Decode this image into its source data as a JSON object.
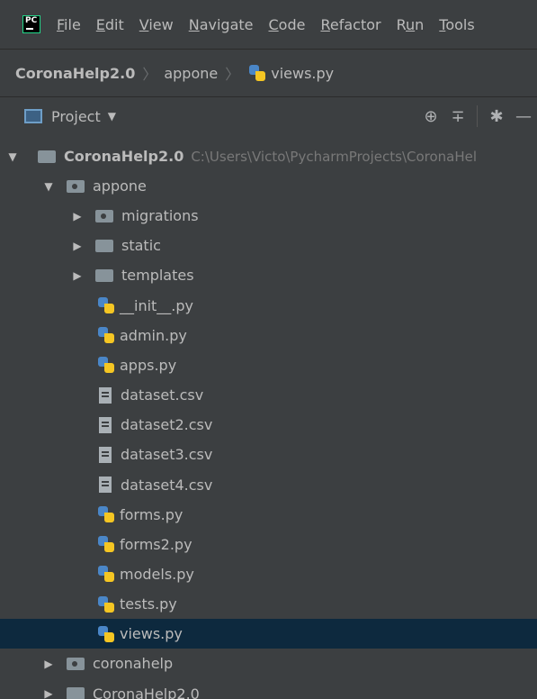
{
  "menubar": {
    "logo_text": "PC",
    "items": [
      "File",
      "Edit",
      "View",
      "Navigate",
      "Code",
      "Refactor",
      "Run",
      "Tools"
    ],
    "mnemonics": [
      "F",
      "E",
      "V",
      "N",
      "C",
      "R",
      "u",
      "T"
    ]
  },
  "breadcrumb": {
    "project": "CoronaHelp2.0",
    "folder": "appone",
    "file": "views.py"
  },
  "toolwindow": {
    "label": "Project",
    "icons": [
      "locate-icon",
      "collapse-all-icon",
      "gear-icon",
      "minimize-icon"
    ]
  },
  "tree": {
    "root_label": "CoronaHelp2.0",
    "root_path": "C:\\Users\\Victo\\PycharmProjects\\CoronaHel",
    "items": [
      {
        "label": "appone",
        "type": "package",
        "depth": 1,
        "expanded": true
      },
      {
        "label": "migrations",
        "type": "package",
        "depth": 2,
        "expanded": false
      },
      {
        "label": "static",
        "type": "folder",
        "depth": 2,
        "expanded": false
      },
      {
        "label": "templates",
        "type": "folder",
        "depth": 2,
        "expanded": false
      },
      {
        "label": "__init__.py",
        "type": "python",
        "depth": 3
      },
      {
        "label": "admin.py",
        "type": "python",
        "depth": 3
      },
      {
        "label": "apps.py",
        "type": "python",
        "depth": 3
      },
      {
        "label": "dataset.csv",
        "type": "text",
        "depth": 3
      },
      {
        "label": "dataset2.csv",
        "type": "text",
        "depth": 3
      },
      {
        "label": "dataset3.csv",
        "type": "text",
        "depth": 3
      },
      {
        "label": "dataset4.csv",
        "type": "text",
        "depth": 3
      },
      {
        "label": "forms.py",
        "type": "python",
        "depth": 3
      },
      {
        "label": "forms2.py",
        "type": "python",
        "depth": 3
      },
      {
        "label": "models.py",
        "type": "python",
        "depth": 3
      },
      {
        "label": "tests.py",
        "type": "python",
        "depth": 3
      },
      {
        "label": "views.py",
        "type": "python",
        "depth": 3,
        "selected": true
      },
      {
        "label": "coronahelp",
        "type": "package",
        "depth": 1,
        "expanded": false
      },
      {
        "label": "CoronaHelp2.0",
        "type": "folder",
        "depth": 1,
        "expanded": false
      }
    ]
  },
  "colors": {
    "background": "#3c3f41",
    "selection": "#0d293e",
    "text": "#bbbbbb",
    "path_text": "#787878",
    "folder": "#87939a",
    "python_blue": "#4a86c7",
    "python_yellow": "#f5c623"
  }
}
